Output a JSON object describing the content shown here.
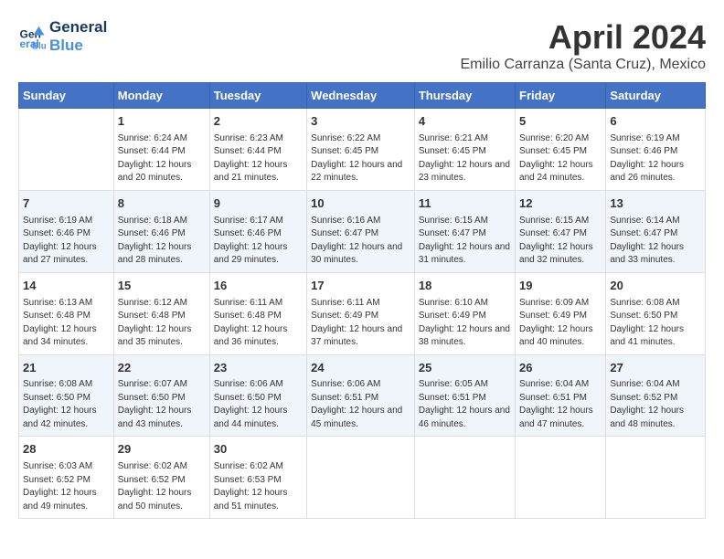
{
  "logo": {
    "line1": "General",
    "line2": "Blue"
  },
  "title": "April 2024",
  "subtitle": "Emilio Carranza (Santa Cruz), Mexico",
  "columns": [
    "Sunday",
    "Monday",
    "Tuesday",
    "Wednesday",
    "Thursday",
    "Friday",
    "Saturday"
  ],
  "weeks": [
    [
      {
        "day": "",
        "sunrise": "",
        "sunset": "",
        "daylight": ""
      },
      {
        "day": "1",
        "sunrise": "Sunrise: 6:24 AM",
        "sunset": "Sunset: 6:44 PM",
        "daylight": "Daylight: 12 hours and 20 minutes."
      },
      {
        "day": "2",
        "sunrise": "Sunrise: 6:23 AM",
        "sunset": "Sunset: 6:44 PM",
        "daylight": "Daylight: 12 hours and 21 minutes."
      },
      {
        "day": "3",
        "sunrise": "Sunrise: 6:22 AM",
        "sunset": "Sunset: 6:45 PM",
        "daylight": "Daylight: 12 hours and 22 minutes."
      },
      {
        "day": "4",
        "sunrise": "Sunrise: 6:21 AM",
        "sunset": "Sunset: 6:45 PM",
        "daylight": "Daylight: 12 hours and 23 minutes."
      },
      {
        "day": "5",
        "sunrise": "Sunrise: 6:20 AM",
        "sunset": "Sunset: 6:45 PM",
        "daylight": "Daylight: 12 hours and 24 minutes."
      },
      {
        "day": "6",
        "sunrise": "Sunrise: 6:19 AM",
        "sunset": "Sunset: 6:46 PM",
        "daylight": "Daylight: 12 hours and 26 minutes."
      }
    ],
    [
      {
        "day": "7",
        "sunrise": "Sunrise: 6:19 AM",
        "sunset": "Sunset: 6:46 PM",
        "daylight": "Daylight: 12 hours and 27 minutes."
      },
      {
        "day": "8",
        "sunrise": "Sunrise: 6:18 AM",
        "sunset": "Sunset: 6:46 PM",
        "daylight": "Daylight: 12 hours and 28 minutes."
      },
      {
        "day": "9",
        "sunrise": "Sunrise: 6:17 AM",
        "sunset": "Sunset: 6:46 PM",
        "daylight": "Daylight: 12 hours and 29 minutes."
      },
      {
        "day": "10",
        "sunrise": "Sunrise: 6:16 AM",
        "sunset": "Sunset: 6:47 PM",
        "daylight": "Daylight: 12 hours and 30 minutes."
      },
      {
        "day": "11",
        "sunrise": "Sunrise: 6:15 AM",
        "sunset": "Sunset: 6:47 PM",
        "daylight": "Daylight: 12 hours and 31 minutes."
      },
      {
        "day": "12",
        "sunrise": "Sunrise: 6:15 AM",
        "sunset": "Sunset: 6:47 PM",
        "daylight": "Daylight: 12 hours and 32 minutes."
      },
      {
        "day": "13",
        "sunrise": "Sunrise: 6:14 AM",
        "sunset": "Sunset: 6:47 PM",
        "daylight": "Daylight: 12 hours and 33 minutes."
      }
    ],
    [
      {
        "day": "14",
        "sunrise": "Sunrise: 6:13 AM",
        "sunset": "Sunset: 6:48 PM",
        "daylight": "Daylight: 12 hours and 34 minutes."
      },
      {
        "day": "15",
        "sunrise": "Sunrise: 6:12 AM",
        "sunset": "Sunset: 6:48 PM",
        "daylight": "Daylight: 12 hours and 35 minutes."
      },
      {
        "day": "16",
        "sunrise": "Sunrise: 6:11 AM",
        "sunset": "Sunset: 6:48 PM",
        "daylight": "Daylight: 12 hours and 36 minutes."
      },
      {
        "day": "17",
        "sunrise": "Sunrise: 6:11 AM",
        "sunset": "Sunset: 6:49 PM",
        "daylight": "Daylight: 12 hours and 37 minutes."
      },
      {
        "day": "18",
        "sunrise": "Sunrise: 6:10 AM",
        "sunset": "Sunset: 6:49 PM",
        "daylight": "Daylight: 12 hours and 38 minutes."
      },
      {
        "day": "19",
        "sunrise": "Sunrise: 6:09 AM",
        "sunset": "Sunset: 6:49 PM",
        "daylight": "Daylight: 12 hours and 40 minutes."
      },
      {
        "day": "20",
        "sunrise": "Sunrise: 6:08 AM",
        "sunset": "Sunset: 6:50 PM",
        "daylight": "Daylight: 12 hours and 41 minutes."
      }
    ],
    [
      {
        "day": "21",
        "sunrise": "Sunrise: 6:08 AM",
        "sunset": "Sunset: 6:50 PM",
        "daylight": "Daylight: 12 hours and 42 minutes."
      },
      {
        "day": "22",
        "sunrise": "Sunrise: 6:07 AM",
        "sunset": "Sunset: 6:50 PM",
        "daylight": "Daylight: 12 hours and 43 minutes."
      },
      {
        "day": "23",
        "sunrise": "Sunrise: 6:06 AM",
        "sunset": "Sunset: 6:50 PM",
        "daylight": "Daylight: 12 hours and 44 minutes."
      },
      {
        "day": "24",
        "sunrise": "Sunrise: 6:06 AM",
        "sunset": "Sunset: 6:51 PM",
        "daylight": "Daylight: 12 hours and 45 minutes."
      },
      {
        "day": "25",
        "sunrise": "Sunrise: 6:05 AM",
        "sunset": "Sunset: 6:51 PM",
        "daylight": "Daylight: 12 hours and 46 minutes."
      },
      {
        "day": "26",
        "sunrise": "Sunrise: 6:04 AM",
        "sunset": "Sunset: 6:51 PM",
        "daylight": "Daylight: 12 hours and 47 minutes."
      },
      {
        "day": "27",
        "sunrise": "Sunrise: 6:04 AM",
        "sunset": "Sunset: 6:52 PM",
        "daylight": "Daylight: 12 hours and 48 minutes."
      }
    ],
    [
      {
        "day": "28",
        "sunrise": "Sunrise: 6:03 AM",
        "sunset": "Sunset: 6:52 PM",
        "daylight": "Daylight: 12 hours and 49 minutes."
      },
      {
        "day": "29",
        "sunrise": "Sunrise: 6:02 AM",
        "sunset": "Sunset: 6:52 PM",
        "daylight": "Daylight: 12 hours and 50 minutes."
      },
      {
        "day": "30",
        "sunrise": "Sunrise: 6:02 AM",
        "sunset": "Sunset: 6:53 PM",
        "daylight": "Daylight: 12 hours and 51 minutes."
      },
      {
        "day": "",
        "sunrise": "",
        "sunset": "",
        "daylight": ""
      },
      {
        "day": "",
        "sunrise": "",
        "sunset": "",
        "daylight": ""
      },
      {
        "day": "",
        "sunrise": "",
        "sunset": "",
        "daylight": ""
      },
      {
        "day": "",
        "sunrise": "",
        "sunset": "",
        "daylight": ""
      }
    ]
  ]
}
